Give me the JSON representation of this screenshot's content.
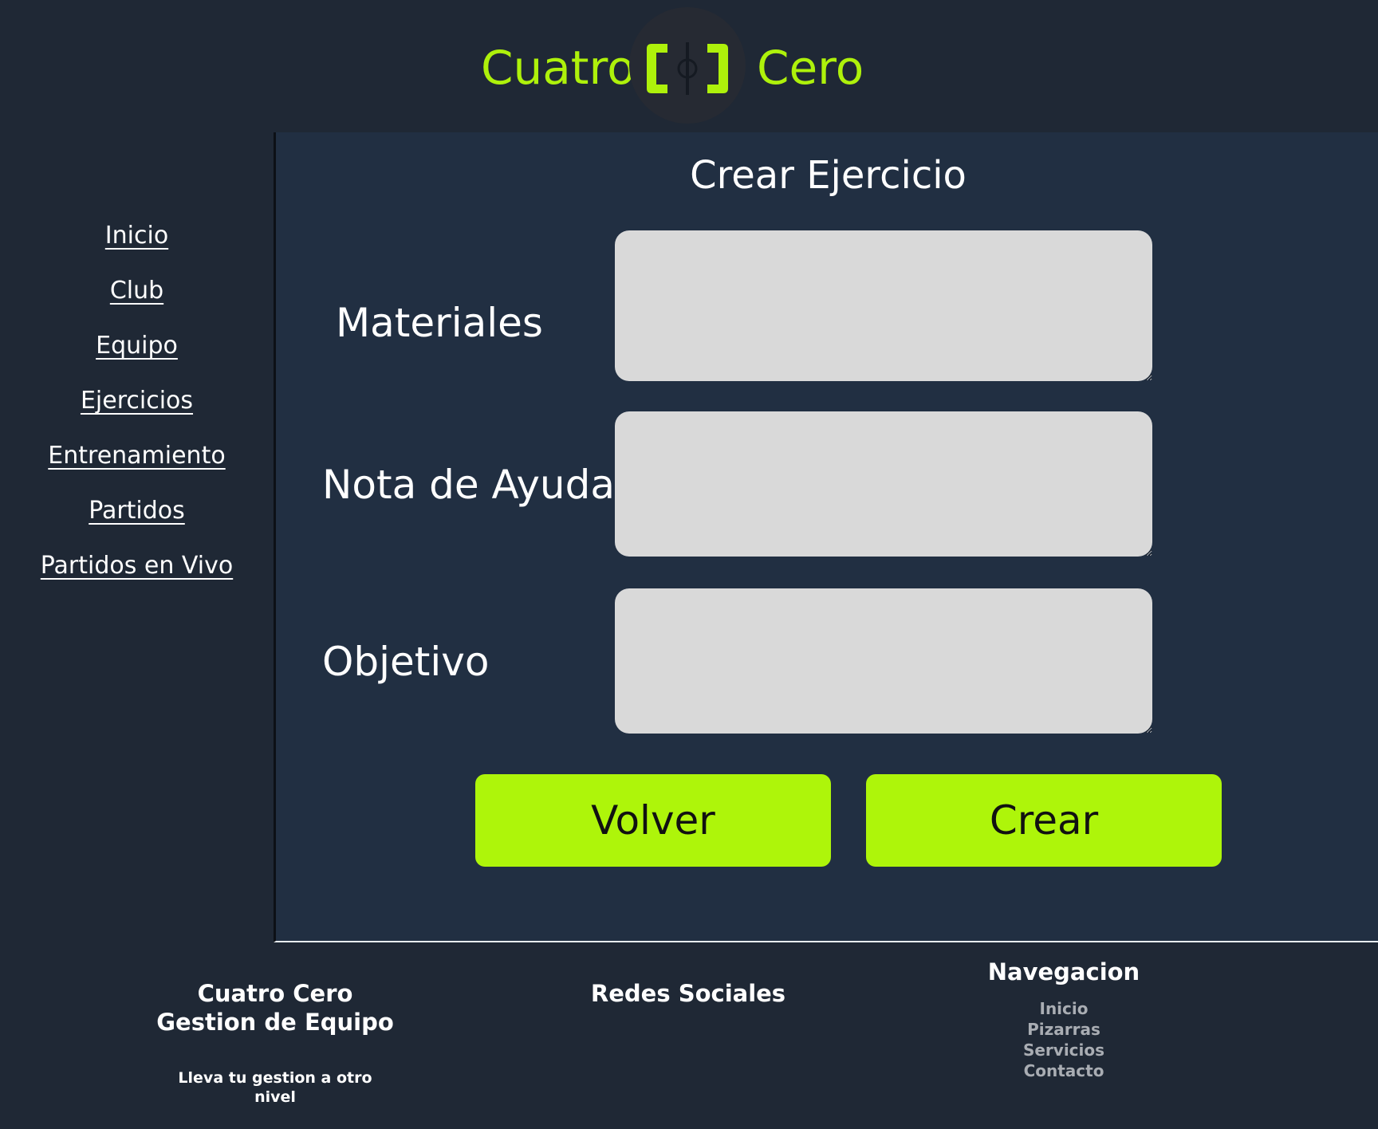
{
  "header": {
    "brand_left": "Cuatro",
    "brand_right": "Cero",
    "logo_icon": "cuatro-cero-logo-icon",
    "accent_color": "#aef10b"
  },
  "sidebar": {
    "items": [
      {
        "label": "Inicio"
      },
      {
        "label": "Club"
      },
      {
        "label": "Equipo"
      },
      {
        "label": "Ejercicios"
      },
      {
        "label": "Entrenamiento"
      },
      {
        "label": "Partidos"
      },
      {
        "label": "Partidos en Vivo"
      }
    ]
  },
  "form": {
    "title": "Crear Ejercicio",
    "fields": [
      {
        "label": "Materiales",
        "value": ""
      },
      {
        "label": "Nota de Ayuda",
        "value": ""
      },
      {
        "label": "Objetivo",
        "value": ""
      }
    ],
    "back_label": "Volver",
    "create_label": "Crear",
    "button_color": "#aef50a"
  },
  "footer": {
    "brand_title_line1": "Cuatro Cero",
    "brand_title_line2": "Gestion de Equipo",
    "tagline": "Lleva tu gestion a otro nivel",
    "social_title": "Redes Sociales",
    "nav_title": "Navegacion",
    "nav_links": [
      {
        "label": "Inicio"
      },
      {
        "label": "Pizarras"
      },
      {
        "label": "Servicios"
      },
      {
        "label": "Contacto"
      }
    ]
  }
}
